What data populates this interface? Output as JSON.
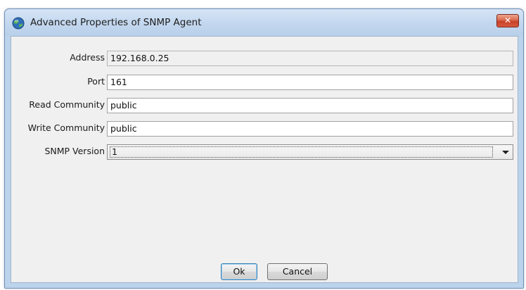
{
  "dialog": {
    "title": "Advanced Properties of SNMP Agent",
    "close_glyph": "✕",
    "icon": "globe-icon"
  },
  "form": {
    "address": {
      "label": "Address",
      "value": "192.168.0.25",
      "editable": false
    },
    "port": {
      "label": "Port",
      "value": "161"
    },
    "read_community": {
      "label": "Read Community",
      "value": "public"
    },
    "write_community": {
      "label": "Write Community",
      "value": "public"
    },
    "snmp_version": {
      "label": "SNMP Version",
      "selected": "1"
    }
  },
  "buttons": {
    "ok_label": "Ok",
    "cancel_label": "Cancel"
  },
  "colors": {
    "frame": "#bcd3ec",
    "client_bg": "#f0f0f0",
    "close_red": "#c6412a"
  }
}
